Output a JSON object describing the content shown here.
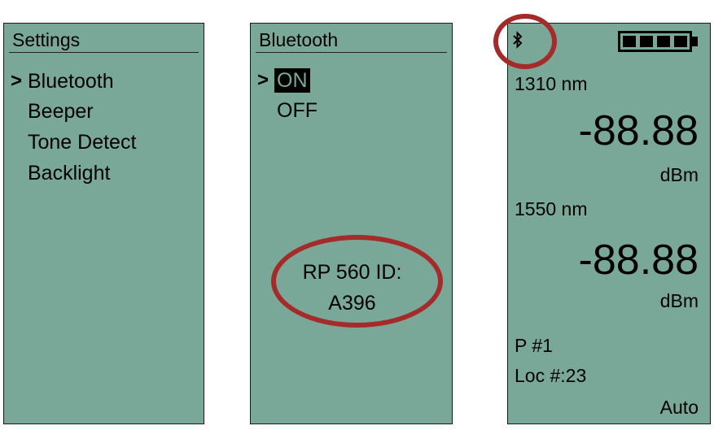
{
  "settings": {
    "title": "Settings",
    "cursor": ">",
    "items": [
      "Bluetooth",
      "Beeper",
      "Tone Detect",
      "Backlight"
    ]
  },
  "bluetooth": {
    "title": "Bluetooth",
    "cursor": ">",
    "options": [
      "ON",
      "OFF"
    ],
    "selected": "ON",
    "id_line1": "RP 560 ID:",
    "id_line2": "A396"
  },
  "meter": {
    "bluetooth_icon": "bluetooth-icon",
    "battery_icon": "battery-full-icon",
    "battery_level": 1.0,
    "ch1_wavelength": "1310 nm",
    "ch1_value": "-88.88",
    "ch1_unit": "dBm",
    "ch2_wavelength": "1550 nm",
    "ch2_value": "-88.88",
    "ch2_unit": "dBm",
    "profile": "P #1",
    "location": "Loc #:23",
    "mode": "Auto"
  },
  "colors": {
    "screen_bg": "#7aa898",
    "highlight_ring": "#a52a2a"
  }
}
